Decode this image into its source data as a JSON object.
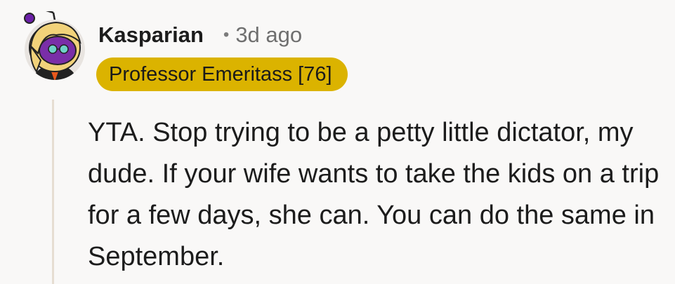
{
  "comment": {
    "author": "Kasparian",
    "separator": "•",
    "age": "3d ago",
    "flair": "Professor Emeritass [76]",
    "body": "YTA. Stop trying to be a petty little dictator, my dude. If your wife wants to take the kids on a trip for a few days, she can. You can do the same in September."
  },
  "icons": {
    "avatar": "snoo-avatar-icon"
  },
  "colors": {
    "flair_background": "#dbb300",
    "thread_line": "#e6ddd2",
    "background": "#f9f8f7"
  }
}
